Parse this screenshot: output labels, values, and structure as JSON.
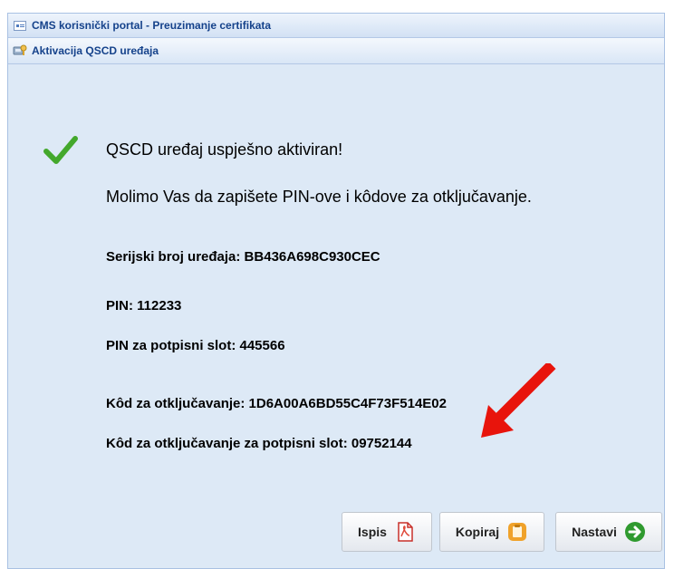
{
  "window": {
    "title": "CMS korisnički portal - Preuzimanje certifikata"
  },
  "panel": {
    "title": "Aktivacija QSCD uređaja"
  },
  "messages": {
    "success": "QSCD uređaj uspješno aktiviran!",
    "instruction": "Molimo Vas da zapišete PIN-ove i kôdove za otključavanje."
  },
  "details": {
    "serial": "Serijski broj uređaja: BB436A698C930CEC",
    "pin": "PIN: 112233",
    "pin_sign": "PIN za potpisni slot: 445566",
    "unlock": "Kôd za otključavanje: 1D6A00A6BD55C4F73F514E02",
    "unlock_sign": "Kôd za otključavanje za potpisni slot: 09752144"
  },
  "buttons": {
    "print": "Ispis",
    "copy": "Kopiraj",
    "next": "Nastavi"
  },
  "icons": {
    "window": "window-icon",
    "panel": "device-key-icon",
    "success": "checkmark-icon",
    "print": "pdf-icon",
    "copy": "clipboard-icon",
    "next": "arrow-right-icon",
    "annotation": "red-arrow-annotation"
  },
  "colors": {
    "title_text": "#15428b",
    "check": "#43a82c",
    "arrow": "#e8140c",
    "next": "#2f9a2f",
    "copy": "#f0a22a"
  }
}
